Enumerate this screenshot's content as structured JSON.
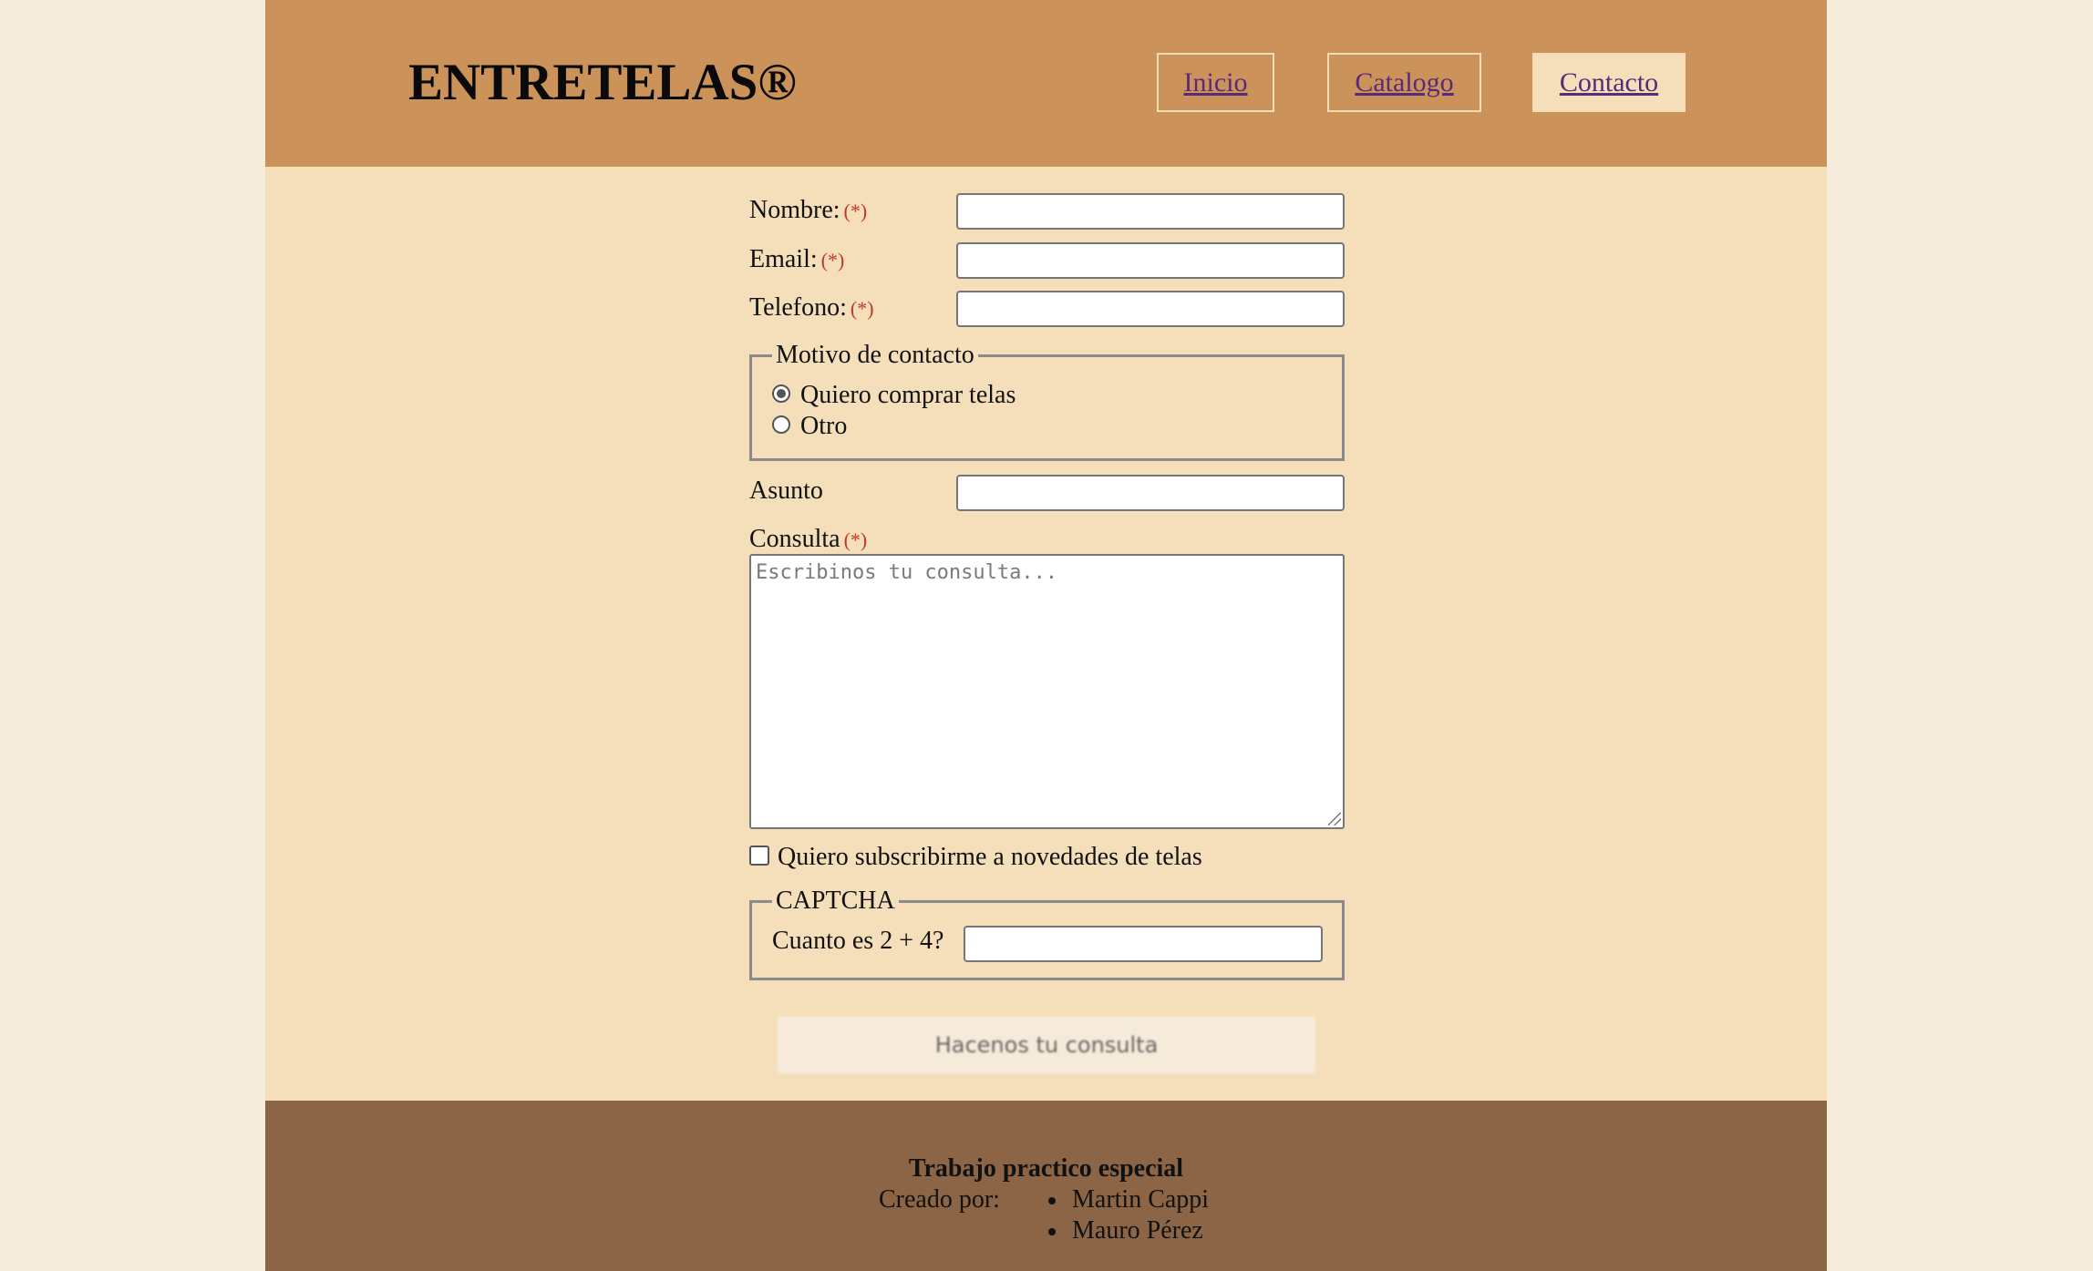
{
  "header": {
    "logo": "ENTRETELAS®",
    "nav": [
      {
        "label": "Inicio",
        "active": false
      },
      {
        "label": "Catalogo",
        "active": false
      },
      {
        "label": "Contacto",
        "active": true
      }
    ]
  },
  "form": {
    "required_marker": "(*)",
    "nombre_label": "Nombre:",
    "email_label": "Email:",
    "telefono_label": "Telefono:",
    "motivo": {
      "legend": "Motivo de contacto",
      "options": [
        {
          "label": "Quiero comprar telas",
          "checked": true
        },
        {
          "label": "Otro",
          "checked": false
        }
      ]
    },
    "asunto_label": "Asunto",
    "consulta_label": "Consulta",
    "consulta_placeholder": "Escribinos tu consulta...",
    "subscribe_label": "Quiero subscribirme a novedades de telas",
    "subscribe_checked": false,
    "captcha": {
      "legend": "CAPTCHA",
      "question": "Cuanto es 2 + 4?"
    },
    "submit_label": "Hacenos tu consulta"
  },
  "footer": {
    "title": "Trabajo practico especial",
    "created_by": "Creado por:",
    "authors": [
      "Martin Cappi",
      "Mauro Pérez"
    ]
  },
  "colors": {
    "background": "#f5ecdc",
    "header": "#cb935a",
    "content": "#f5dfbb",
    "footer": "#8b6545",
    "link": "#5a2a7a",
    "required": "#c0392b"
  }
}
